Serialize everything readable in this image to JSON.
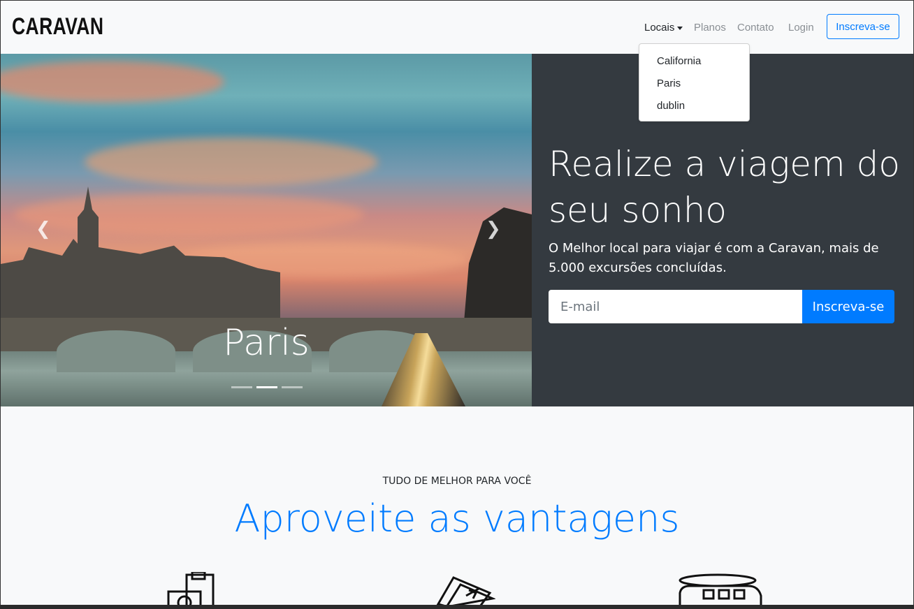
{
  "navbar": {
    "brand": "CARAVAN",
    "links": {
      "locais": "Locais",
      "planos": "Planos",
      "contato": "Contato",
      "login": "Login"
    },
    "signup_button": "Inscreva-se"
  },
  "dropdown": {
    "items": [
      "California",
      "Paris",
      "dublin"
    ]
  },
  "carousel": {
    "caption": "Paris",
    "prev_icon": "chevron-left-icon",
    "next_icon": "chevron-right-icon",
    "slide_count": 3,
    "active_slide": 2
  },
  "hero": {
    "title": "Realize a viagem do seu sonho",
    "text": "O Melhor local para viajar é com a Caravan, mais de 5.000 excursões concluídas.",
    "email_placeholder": "E-mail",
    "submit_label": "Inscreva-se"
  },
  "features": {
    "subtitle": "TUDO DE MELHOR PARA VOCÊ",
    "title": "Aproveite as vantagens",
    "icons": [
      "passport-icon",
      "plane-ticket-icon",
      "bus-icon"
    ]
  },
  "colors": {
    "primary": "#007bff",
    "dark": "#343a40",
    "light": "#f8f9fa"
  }
}
